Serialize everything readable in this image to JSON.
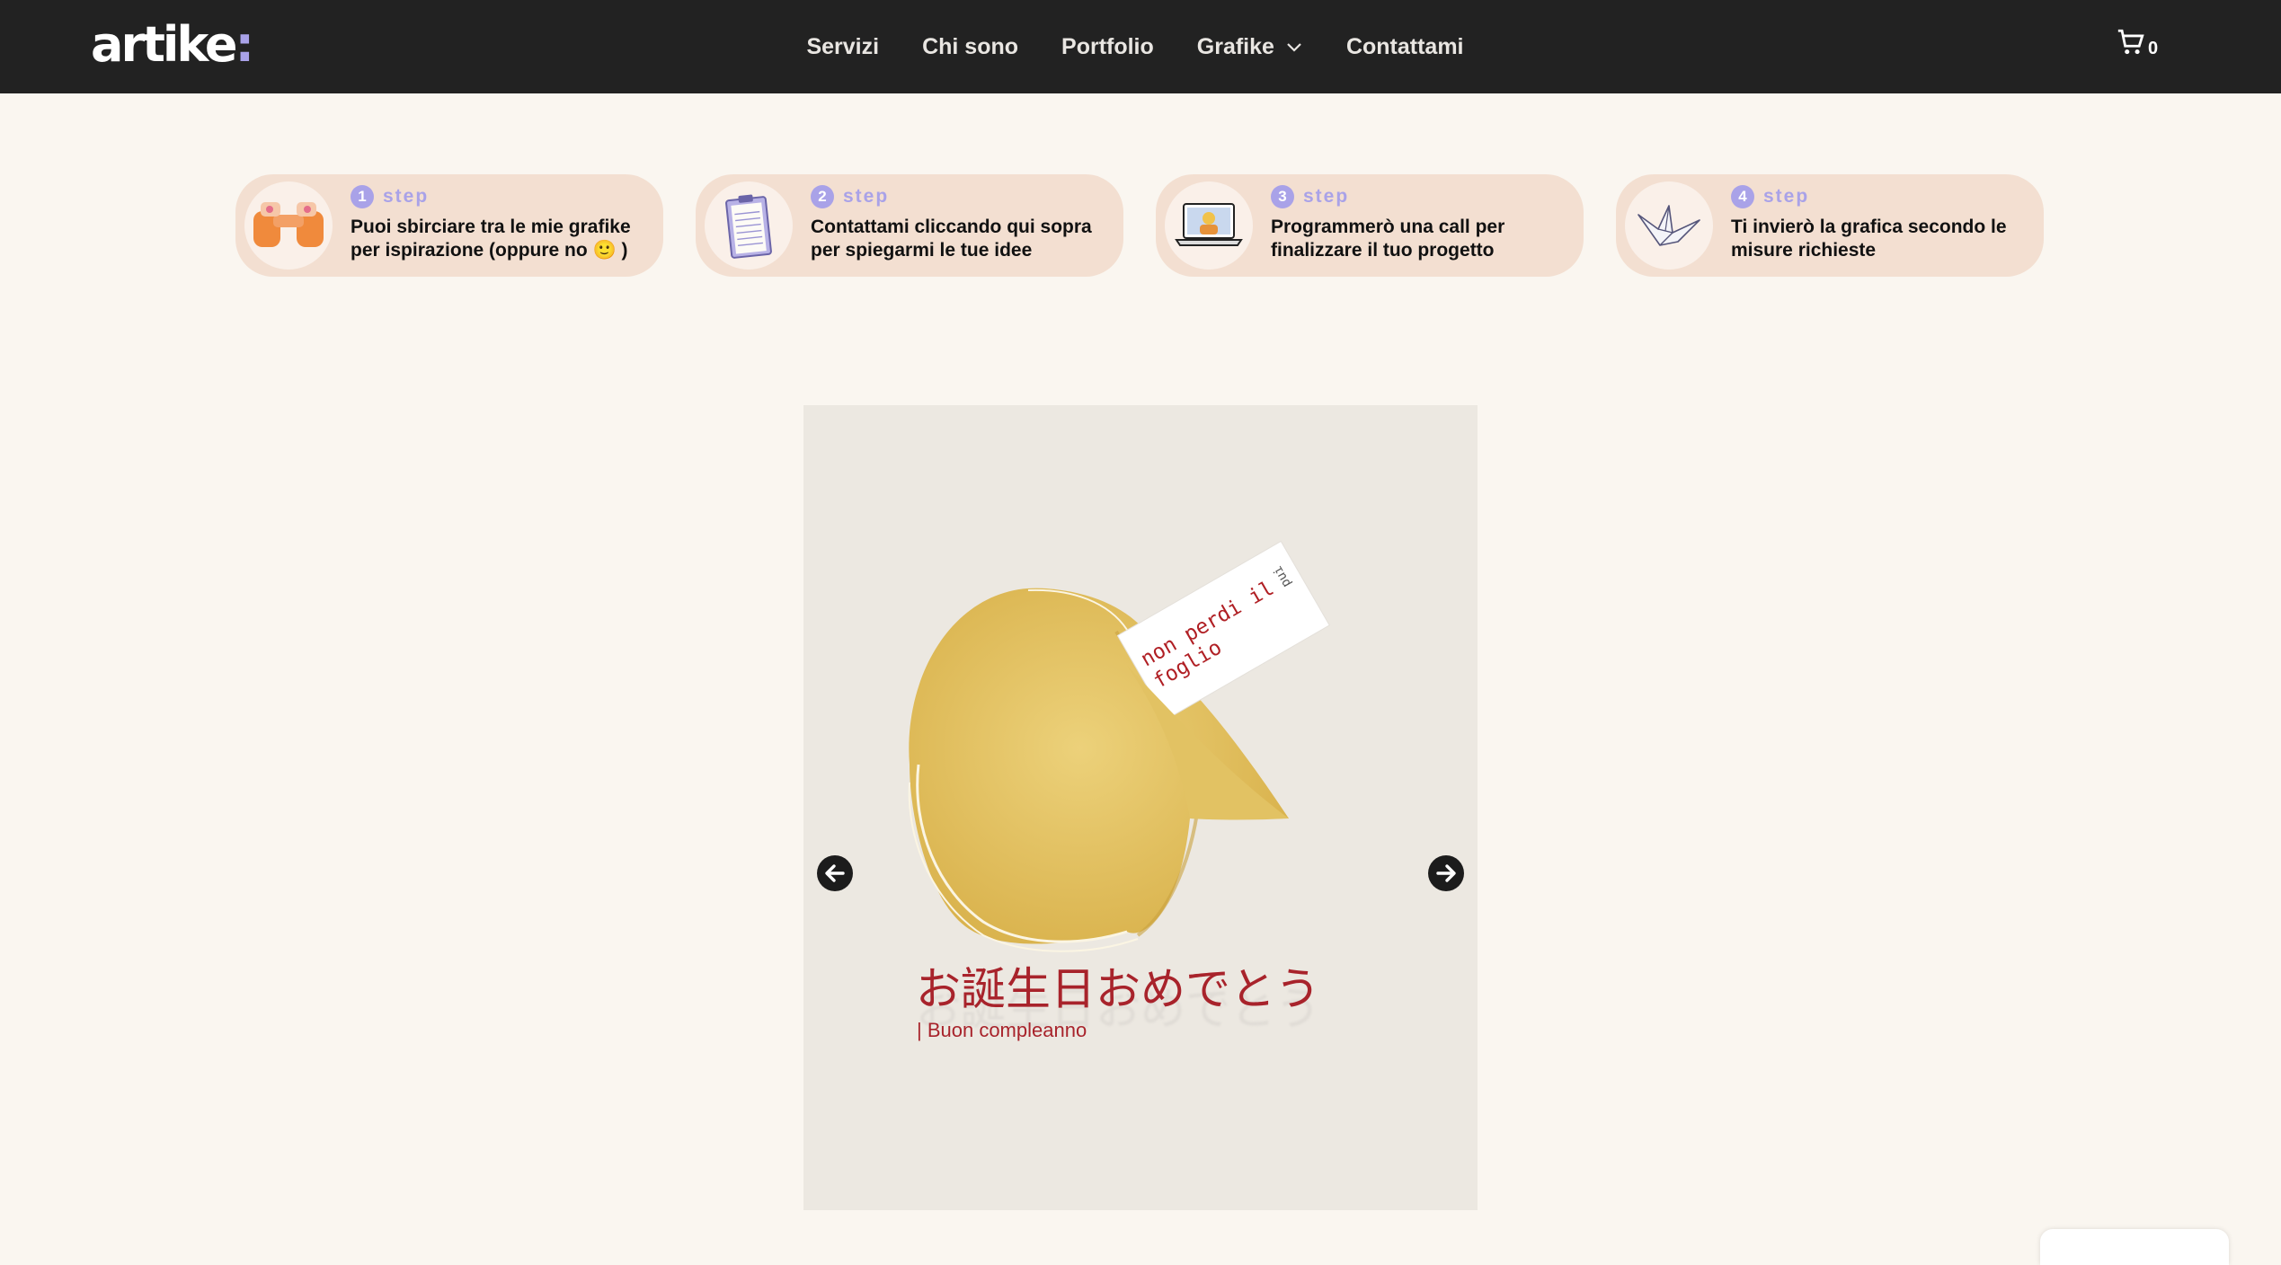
{
  "header": {
    "logo_text": "artike",
    "logo_accent": ":",
    "nav": [
      {
        "label": "Servizi"
      },
      {
        "label": "Chi sono"
      },
      {
        "label": "Portfolio"
      },
      {
        "label": "Grafike",
        "has_dropdown": true
      },
      {
        "label": "Contattami"
      }
    ],
    "cart_count": "0"
  },
  "steps": [
    {
      "num": "1",
      "label": "step",
      "text": "Puoi sbirciare tra le mie grafike per ispirazione (oppure no 🙂 )",
      "icon": "binoculars-icon"
    },
    {
      "num": "2",
      "label": "step",
      "text": "Contattami cliccando qui sopra per spiegarmi le tue idee",
      "icon": "clipboard-icon"
    },
    {
      "num": "3",
      "label": "step",
      "text": "Programmerò una call per finalizzare il tuo progetto",
      "icon": "laptop-call-icon"
    },
    {
      "num": "4",
      "label": "step",
      "text": "Ti invierò la grafica secondo le misure richieste",
      "icon": "paper-crane-icon"
    }
  ],
  "slide": {
    "note_line1": "non perdi il",
    "note_line2": "foglio",
    "note_corner": "ᴉnd",
    "greeting_jp": "お誕生日おめでとう",
    "greeting_it": "| Buon compleanno"
  },
  "colors": {
    "navbar": "#222222",
    "page_bg": "#faf6f0",
    "step_bg": "#f3dfd1",
    "accent": "#a9a2e8",
    "greeting": "#a8232b"
  }
}
